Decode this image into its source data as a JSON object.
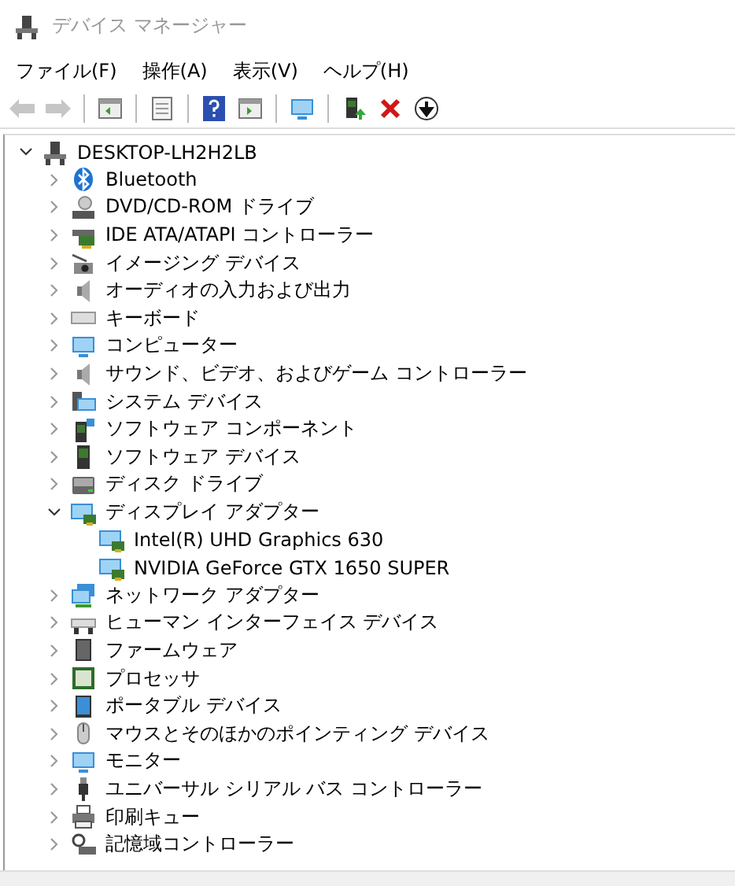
{
  "window": {
    "title": "デバイス マネージャー"
  },
  "menu": [
    {
      "label": "ファイル(F)"
    },
    {
      "label": "操作(A)"
    },
    {
      "label": "表示(V)"
    },
    {
      "label": "ヘルプ(H)"
    }
  ],
  "toolbar": {
    "back_disabled": true,
    "forward_disabled": true
  },
  "tree": {
    "label": "DESKTOP-LH2H2LB",
    "expanded": true,
    "children": [
      {
        "label": "Bluetooth",
        "expanded": false
      },
      {
        "label": "DVD/CD-ROM ドライブ",
        "expanded": false
      },
      {
        "label": "IDE ATA/ATAPI コントローラー",
        "expanded": false
      },
      {
        "label": "イメージング デバイス",
        "expanded": false
      },
      {
        "label": "オーディオの入力および出力",
        "expanded": false
      },
      {
        "label": "キーボード",
        "expanded": false
      },
      {
        "label": "コンピューター",
        "expanded": false
      },
      {
        "label": "サウンド、ビデオ、およびゲーム コントローラー",
        "expanded": false
      },
      {
        "label": "システム デバイス",
        "expanded": false
      },
      {
        "label": "ソフトウェア コンポーネント",
        "expanded": false
      },
      {
        "label": "ソフトウェア デバイス",
        "expanded": false
      },
      {
        "label": "ディスク ドライブ",
        "expanded": false
      },
      {
        "label": "ディスプレイ アダプター",
        "expanded": true,
        "children": [
          {
            "label": "Intel(R) UHD Graphics 630"
          },
          {
            "label": "NVIDIA GeForce GTX 1650 SUPER"
          }
        ]
      },
      {
        "label": "ネットワーク アダプター",
        "expanded": false
      },
      {
        "label": "ヒューマン インターフェイス デバイス",
        "expanded": false
      },
      {
        "label": "ファームウェア",
        "expanded": false
      },
      {
        "label": "プロセッサ",
        "expanded": false
      },
      {
        "label": "ポータブル デバイス",
        "expanded": false
      },
      {
        "label": "マウスとそのほかのポインティング デバイス",
        "expanded": false
      },
      {
        "label": "モニター",
        "expanded": false
      },
      {
        "label": "ユニバーサル シリアル バス コントローラー",
        "expanded": false
      },
      {
        "label": "印刷キュー",
        "expanded": false
      },
      {
        "label": "記憶域コントローラー",
        "expanded": false
      }
    ]
  }
}
